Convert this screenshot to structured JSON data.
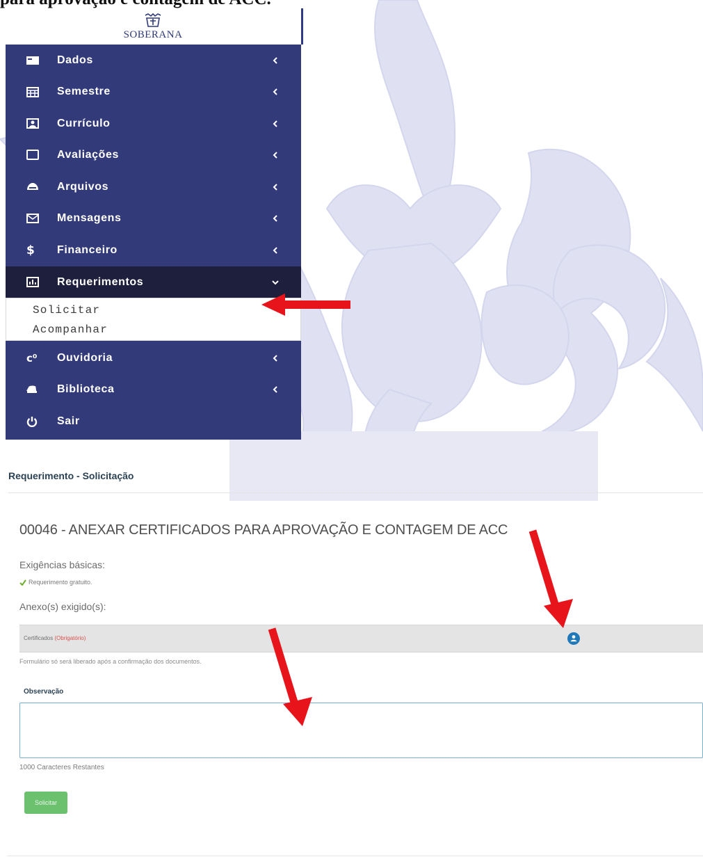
{
  "document": {
    "heading": "para aprovação e contagem de ACC."
  },
  "logo": {
    "text": "SOBERANA"
  },
  "sidebar": {
    "items": [
      {
        "label": "Dados",
        "icon": "id-card-icon",
        "state": "collapsed"
      },
      {
        "label": "Semestre",
        "icon": "calendar-icon",
        "state": "collapsed"
      },
      {
        "label": "Currículo",
        "icon": "portrait-icon",
        "state": "collapsed"
      },
      {
        "label": "Avaliações",
        "icon": "square-icon",
        "state": "collapsed"
      },
      {
        "label": "Arquivos",
        "icon": "cloud-icon",
        "state": "collapsed"
      },
      {
        "label": "Mensagens",
        "icon": "envelope-icon",
        "state": "collapsed"
      },
      {
        "label": "Financeiro",
        "icon": "dollar-icon",
        "state": "collapsed"
      },
      {
        "label": "Requerimentos",
        "icon": "report-icon",
        "state": "expanded"
      },
      {
        "label": "Ouvidoria",
        "icon": "copyright-icon",
        "state": "collapsed"
      },
      {
        "label": "Biblioteca",
        "icon": "car-icon",
        "state": "collapsed"
      },
      {
        "label": "Sair",
        "icon": "power-icon",
        "state": "none"
      }
    ],
    "submenu": [
      {
        "label": "Solicitar"
      },
      {
        "label": "Acompanhar"
      }
    ]
  },
  "form": {
    "title": "Requerimento - Solicitação",
    "request_title": "00046 - ANEXAR CERTIFICADOS PARA APROVAÇÃO E CONTAGEM DE ACC",
    "basic_requirements_label": "Exigências básicas:",
    "basic_requirement_item": "Requerimento gratuito.",
    "attachments_label": "Anexo(s) exigido(s):",
    "attachment": {
      "name": "Certificados",
      "required_tag": "(Obrigatório)"
    },
    "attachment_note": "Formulário só será liberado após a confirmação dos documentos.",
    "observation_label": "Observação",
    "observation_value": "",
    "char_remaining": "1000 Caracteres Restantes",
    "submit_label": "Solicitar"
  },
  "colors": {
    "sidebar_bg": "#323a7a",
    "active_item_bg": "#1d1f3c",
    "arrow": "#e8141b",
    "submit_button": "#6cc16e",
    "attach_button": "#1f79b8",
    "required_text": "#d9534f"
  }
}
